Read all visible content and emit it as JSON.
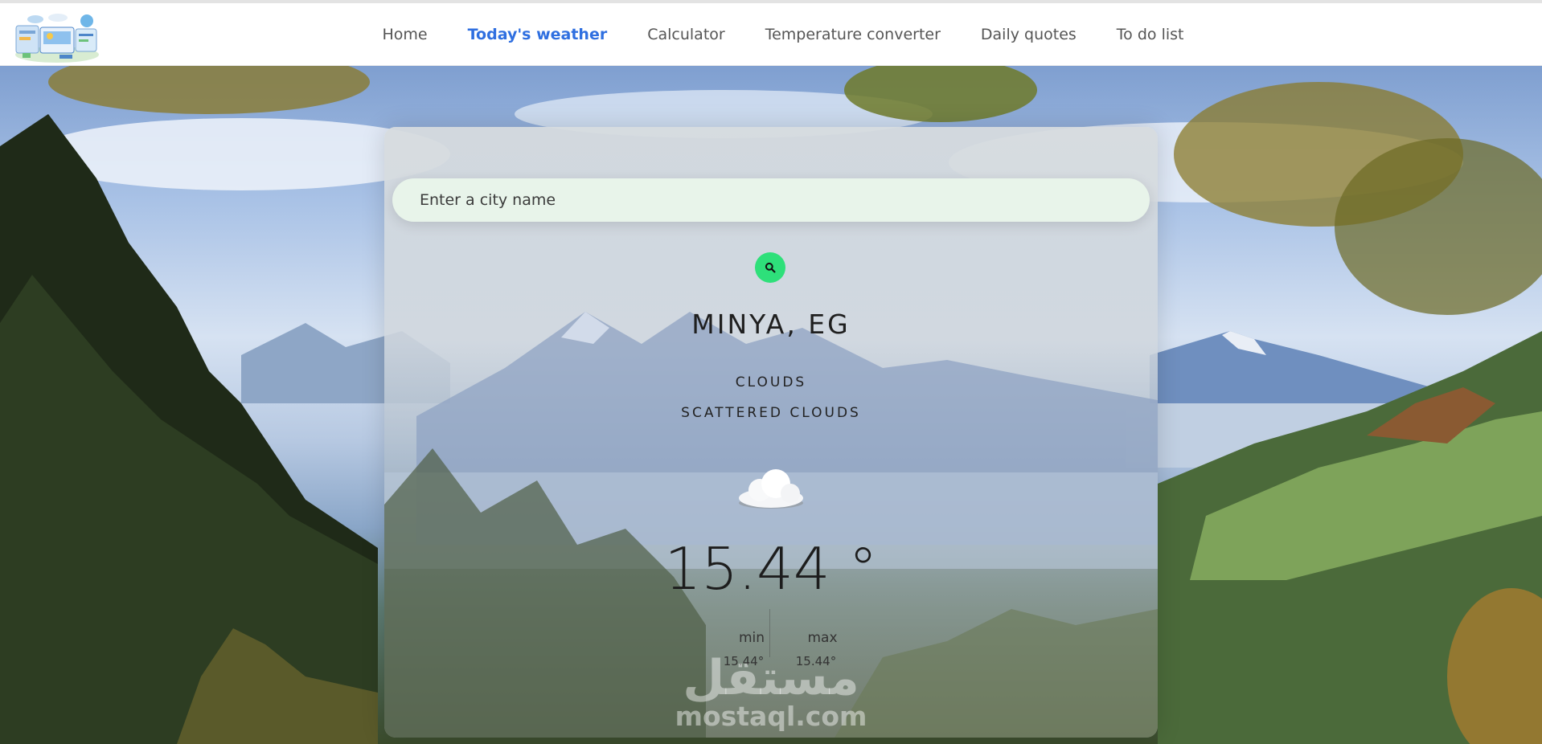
{
  "nav": {
    "items": [
      {
        "label": "Home",
        "active": false
      },
      {
        "label": "Today's weather",
        "active": true
      },
      {
        "label": "Calculator",
        "active": false
      },
      {
        "label": "Temperature converter",
        "active": false
      },
      {
        "label": "Daily quotes",
        "active": false
      },
      {
        "label": "To do list",
        "active": false
      }
    ],
    "logo_icon": "weather-dashboard-logo"
  },
  "search": {
    "placeholder": "Enter a city name",
    "button_icon": "search-icon",
    "button_color": "#2ee07a"
  },
  "weather": {
    "city": "MINYA, EG",
    "condition": "CLOUDS",
    "description": "SCATTERED CLOUDS",
    "icon": "cloud-icon",
    "temperature": "15.44 °",
    "min_label": "min",
    "min_value": "15.44°",
    "max_label": "max",
    "max_value": "15.44°"
  },
  "watermark": {
    "arabic": "مستقل",
    "latin": "mostaql.com"
  },
  "colors": {
    "active_nav": "#2f6fe0",
    "nav_text": "#555555",
    "search_bg": "#e8f4ea"
  }
}
